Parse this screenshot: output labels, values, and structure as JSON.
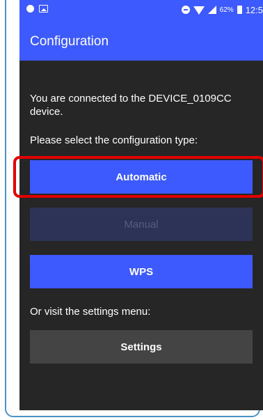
{
  "status_bar": {
    "battery_percent": "62%",
    "time": "12:5"
  },
  "app_bar": {
    "title": "Configuration"
  },
  "main": {
    "connected_text": "You are connected to the DEVICE_0109CC device.",
    "select_prompt": "Please select the configuration type:",
    "buttons": {
      "automatic": "Automatic",
      "manual": "Manual",
      "wps": "WPS",
      "settings": "Settings"
    },
    "manual_enabled": false,
    "settings_prompt": "Or visit the settings menu:"
  },
  "icons": [
    "circle-dot-icon",
    "image-icon",
    "minus-circle-icon",
    "wifi-icon",
    "signal-icon",
    "battery-icon"
  ],
  "colors": {
    "primary": "#3d5aff",
    "background": "#262626",
    "disabled_button": "#2c3356",
    "settings_button": "#444444",
    "highlight": "#e00000",
    "frame_border": "#4a93c6"
  }
}
